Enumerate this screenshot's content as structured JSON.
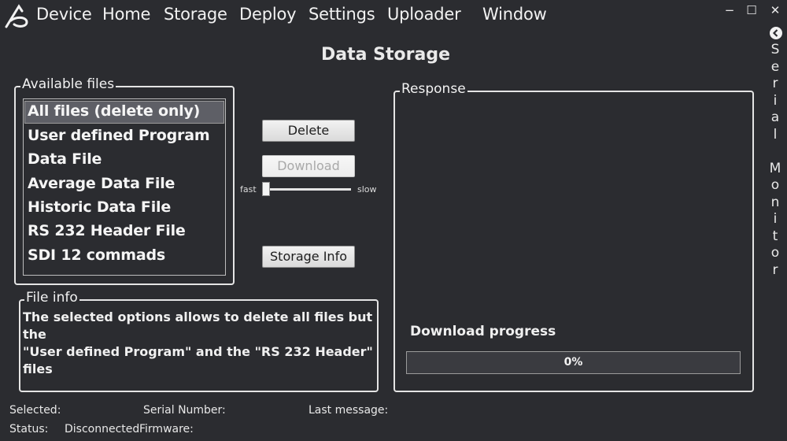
{
  "menu": {
    "items": [
      "Device",
      "Home",
      "Storage",
      "Deploy",
      "Settings",
      "Uploader",
      "Window"
    ]
  },
  "window_controls": {
    "minimize": "−",
    "maximize": "☐",
    "close": "✕"
  },
  "side_panel": {
    "label": "Serial Monitor",
    "letters": [
      "S",
      "e",
      "r",
      "i",
      "a",
      "l",
      "",
      "M",
      "o",
      "n",
      "i",
      "t",
      "o",
      "r"
    ]
  },
  "page": {
    "title": "Data Storage"
  },
  "available_files": {
    "legend": "Available files",
    "items": [
      "All files (delete only)",
      "User defined Program",
      "Data File",
      "Average Data File",
      "Historic Data File",
      "RS 232 Header File",
      "SDI 12 commads"
    ],
    "selected": "All files (delete only)"
  },
  "actions": {
    "delete_label": "Delete",
    "download_label": "Download",
    "storage_info_label": "Storage Info"
  },
  "speed_slider": {
    "min_label": "fast",
    "max_label": "slow",
    "value": 0
  },
  "file_info": {
    "legend": "File info",
    "line1": "The selected options allows to delete all files but the",
    "line2": "\"User defined Program\" and the \"RS 232 Header\" files"
  },
  "response": {
    "legend": "Response"
  },
  "download_progress": {
    "label": "Download progress",
    "value": 0,
    "text": "0%"
  },
  "status_bar": {
    "selected_label": "Selected:",
    "serial_number_label": "Serial Number:",
    "last_message_label": "Last message:",
    "status_label": "Status:",
    "status_value": "Disconnected",
    "firmware_label": "Firmware:"
  },
  "colors": {
    "background": "#2b2c30",
    "accent": "#55c35a"
  }
}
